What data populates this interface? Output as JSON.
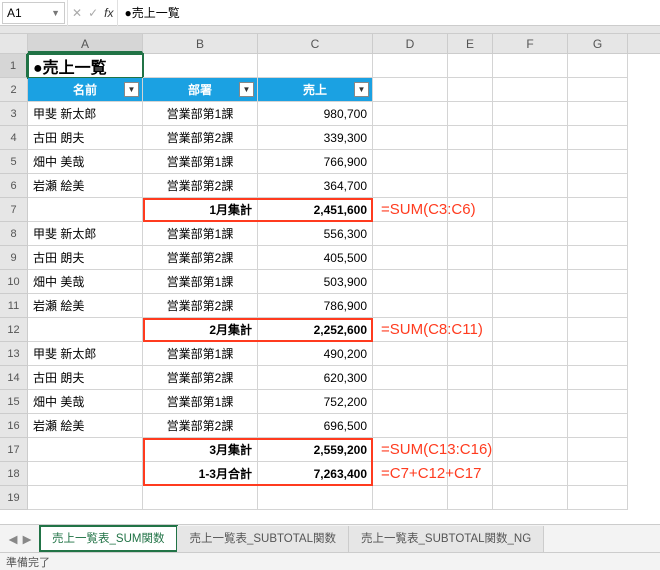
{
  "namebox": "A1",
  "formula_value": "●売上一覧",
  "colheaders": [
    "A",
    "B",
    "C",
    "D",
    "E",
    "F",
    "G"
  ],
  "rowcount": 19,
  "title_cell": "●売上一覧",
  "headers": {
    "name": "名前",
    "dept": "部署",
    "sales": "売上"
  },
  "rows": [
    {
      "name": "甲斐 新太郎",
      "dept": "営業部第1課",
      "sales": "980,700"
    },
    {
      "name": "古田 朗夫",
      "dept": "営業部第2課",
      "sales": "339,300"
    },
    {
      "name": "畑中 美哉",
      "dept": "営業部第1課",
      "sales": "766,900"
    },
    {
      "name": "岩瀬 絵美",
      "dept": "営業部第2課",
      "sales": "364,700"
    },
    {
      "subtotal": true,
      "label": "1月集計",
      "sales": "2,451,600"
    },
    {
      "name": "甲斐 新太郎",
      "dept": "営業部第1課",
      "sales": "556,300"
    },
    {
      "name": "古田 朗夫",
      "dept": "営業部第2課",
      "sales": "405,500"
    },
    {
      "name": "畑中 美哉",
      "dept": "営業部第1課",
      "sales": "503,900"
    },
    {
      "name": "岩瀬 絵美",
      "dept": "営業部第2課",
      "sales": "786,900"
    },
    {
      "subtotal": true,
      "label": "2月集計",
      "sales": "2,252,600"
    },
    {
      "name": "甲斐 新太郎",
      "dept": "営業部第1課",
      "sales": "490,200"
    },
    {
      "name": "古田 朗夫",
      "dept": "営業部第2課",
      "sales": "620,300"
    },
    {
      "name": "畑中 美哉",
      "dept": "営業部第1課",
      "sales": "752,200"
    },
    {
      "name": "岩瀬 絵美",
      "dept": "営業部第2課",
      "sales": "696,500"
    },
    {
      "subtotal": true,
      "label": "3月集計",
      "sales": "2,559,200"
    },
    {
      "subtotal": true,
      "label": "1-3月合計",
      "sales": "7,263,400"
    }
  ],
  "annotations": [
    {
      "text": "=SUM(C3:C6)",
      "row": 7
    },
    {
      "text": "=SUM(C8:C11)",
      "row": 12
    },
    {
      "text": "=SUM(C13:C16)",
      "row": 17
    },
    {
      "text": "=C7+C12+C17",
      "row": 18
    }
  ],
  "tabs": {
    "items": [
      "売上一覧表_SUM関数",
      "売上一覧表_SUBTOTAL関数",
      "売上一覧表_SUBTOTAL関数_NG"
    ],
    "active": 0
  },
  "status": "準備完了",
  "chart_data": {
    "type": "table",
    "columns": [
      "名前",
      "部署",
      "売上"
    ],
    "data": [
      [
        "甲斐 新太郎",
        "営業部第1課",
        980700
      ],
      [
        "古田 朗夫",
        "営業部第2課",
        339300
      ],
      [
        "畑中 美哉",
        "営業部第1課",
        766900
      ],
      [
        "岩瀬 絵美",
        "営業部第2課",
        364700
      ],
      [
        "1月集計",
        "",
        2451600
      ],
      [
        "甲斐 新太郎",
        "営業部第1課",
        556300
      ],
      [
        "古田 朗夫",
        "営業部第2課",
        405500
      ],
      [
        "畑中 美哉",
        "営業部第1課",
        503900
      ],
      [
        "岩瀬 絵美",
        "営業部第2課",
        786900
      ],
      [
        "2月集計",
        "",
        2252600
      ],
      [
        "甲斐 新太郎",
        "営業部第1課",
        490200
      ],
      [
        "古田 朗夫",
        "営業部第2課",
        620300
      ],
      [
        "畑中 美哉",
        "営業部第1課",
        752200
      ],
      [
        "岩瀬 絵美",
        "営業部第2課",
        696500
      ],
      [
        "3月集計",
        "",
        2559200
      ],
      [
        "1-3月合計",
        "",
        7263400
      ]
    ]
  }
}
